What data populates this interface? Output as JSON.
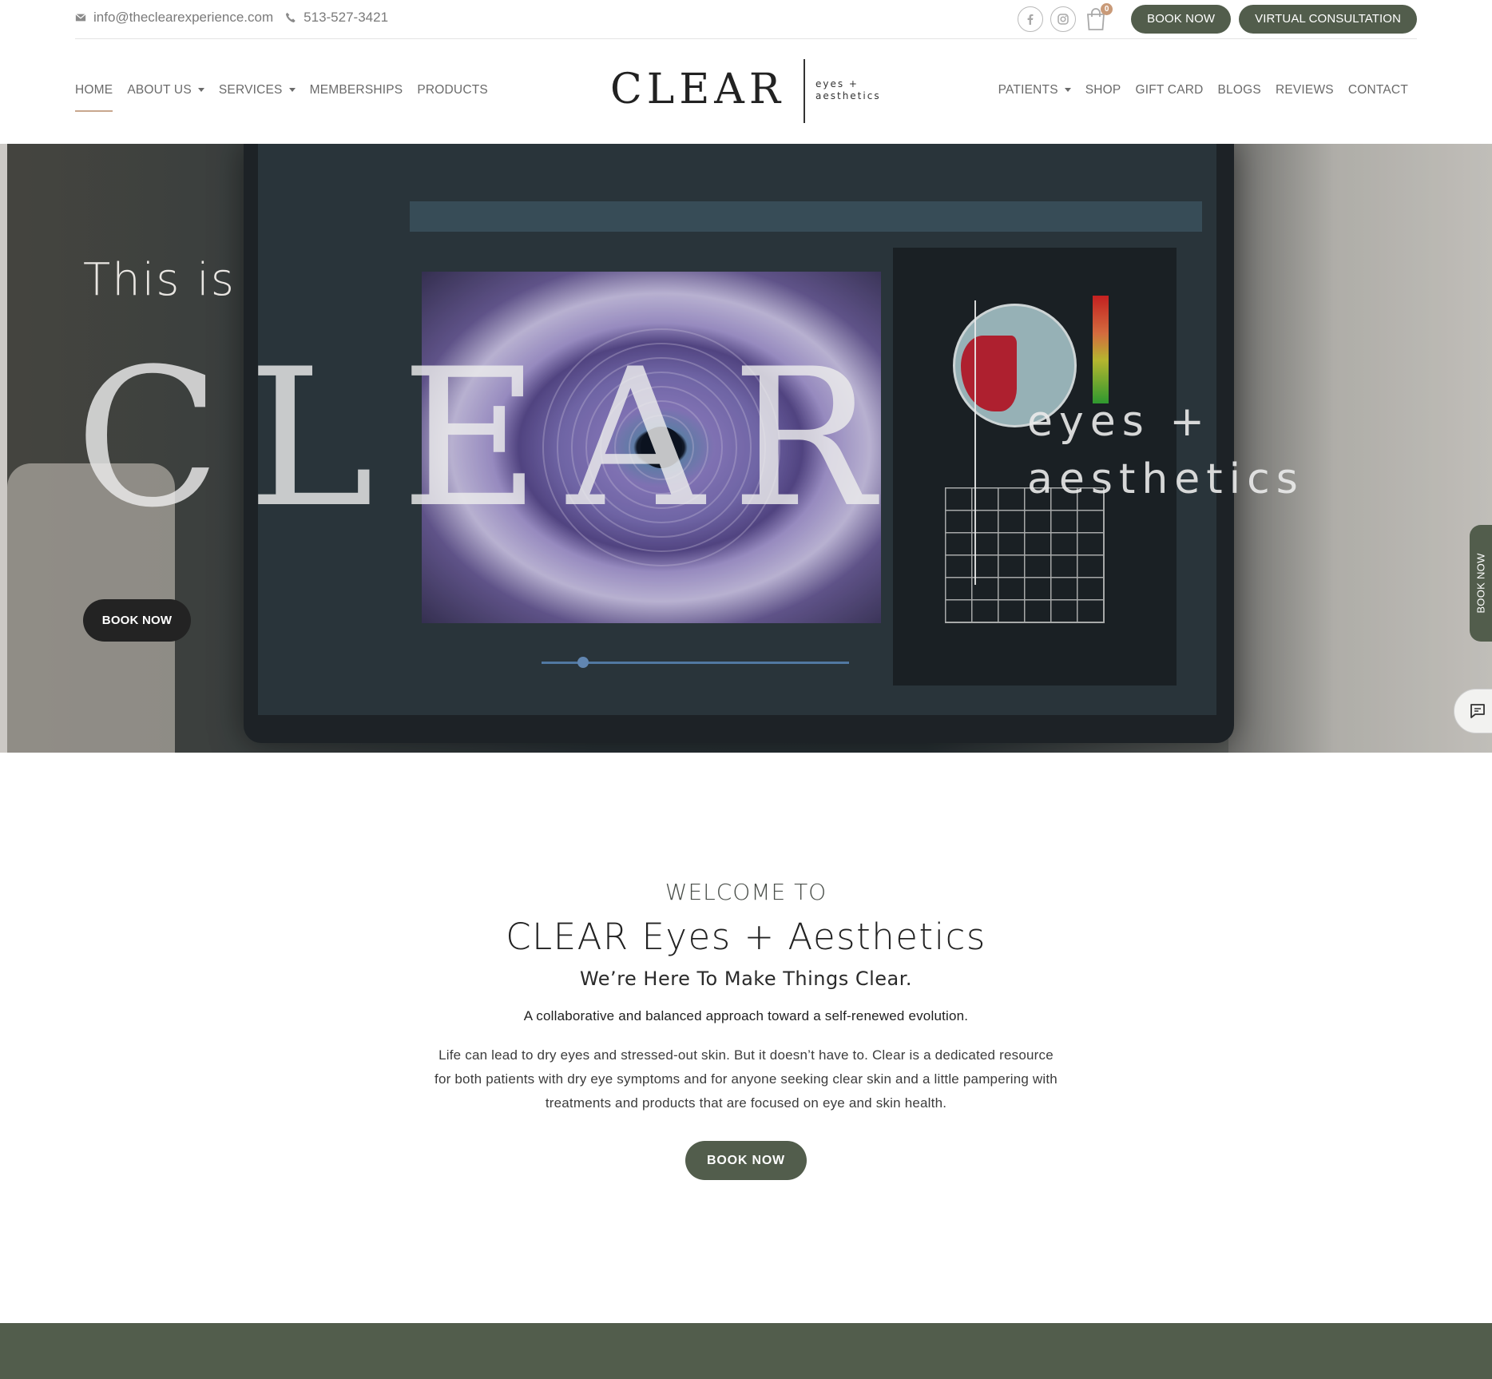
{
  "topbar": {
    "email": "info@theclearexperience.com",
    "phone": "513-527-3421",
    "cart_count": "0",
    "book_now": "BOOK NOW",
    "virtual_consultation": "VIRTUAL CONSULTATION"
  },
  "logo": {
    "word": "CLEAR",
    "sub_line1": "eyes +",
    "sub_line2": "aesthetics"
  },
  "nav": {
    "left": [
      {
        "label": "HOME",
        "active": true,
        "dropdown": false
      },
      {
        "label": "ABOUT US",
        "active": false,
        "dropdown": true
      },
      {
        "label": "SERVICES",
        "active": false,
        "dropdown": true
      },
      {
        "label": "MEMBERSHIPS",
        "active": false,
        "dropdown": false
      },
      {
        "label": "PRODUCTS",
        "active": false,
        "dropdown": false
      }
    ],
    "right": [
      {
        "label": "PATIENTS",
        "active": false,
        "dropdown": true
      },
      {
        "label": "SHOP",
        "active": false,
        "dropdown": false
      },
      {
        "label": "GIFT CARD",
        "active": false,
        "dropdown": false
      },
      {
        "label": "BLOGS",
        "active": false,
        "dropdown": false
      },
      {
        "label": "REVIEWS",
        "active": false,
        "dropdown": false
      },
      {
        "label": "CONTACT",
        "active": false,
        "dropdown": false
      }
    ]
  },
  "hero": {
    "intro": "This is",
    "word": "CLEAR",
    "sub_line1": "eyes +",
    "sub_line2": "aesthetics",
    "book_now": "BOOK NOW",
    "side_tab": "BOOK NOW"
  },
  "welcome": {
    "kicker": "WELCOME TO",
    "title": "CLEAR Eyes + Aesthetics",
    "tagline": "We’re Here To Make Things Clear.",
    "lead": "A collaborative and balanced approach toward a self-renewed evolution.",
    "body": "Life can lead to dry eyes and stressed-out skin. But it doesn’t have to. Clear is a dedicated resource for both patients with dry eye symptoms and for anyone seeking clear skin and a little pampering with treatments and products that are focused on eye and skin health.",
    "book_now": "BOOK NOW"
  },
  "colors": {
    "brand_green": "#525d4c",
    "accent_tan": "#c8a78e",
    "dark_button": "#232323"
  },
  "icons": [
    "envelope-icon",
    "phone-icon",
    "facebook-icon",
    "instagram-icon",
    "cart-icon",
    "chat-icon"
  ]
}
